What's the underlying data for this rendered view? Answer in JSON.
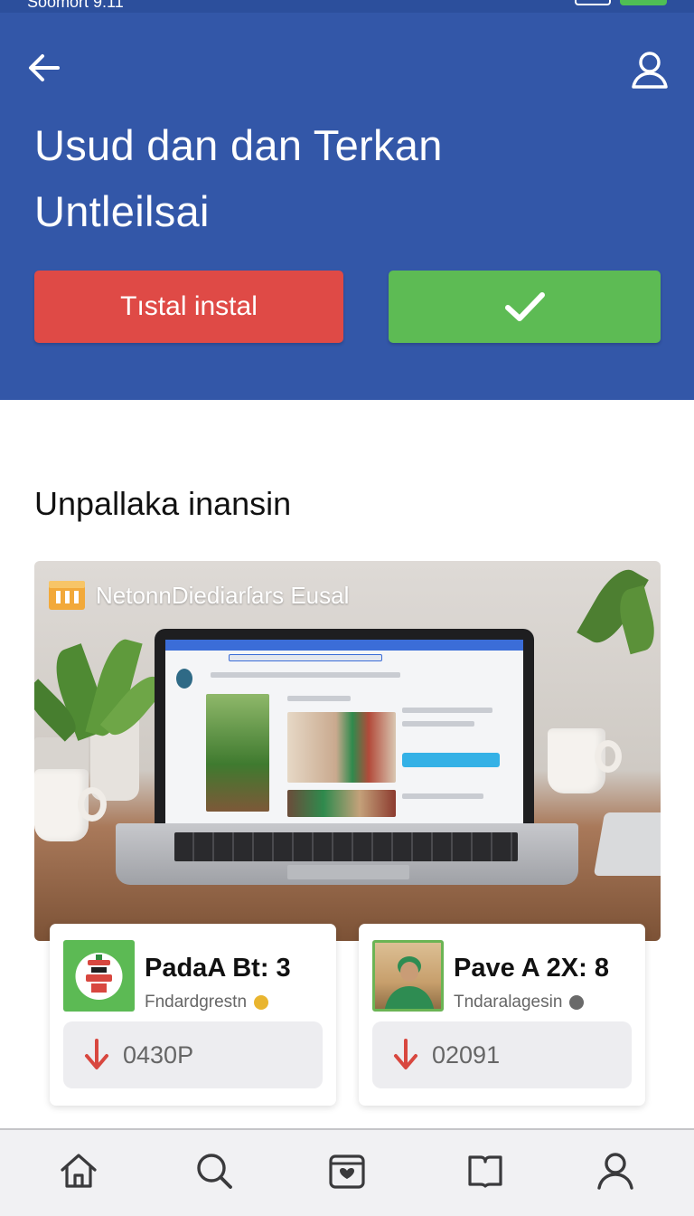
{
  "status_bar": {
    "left_text": "Soomort 9:11"
  },
  "header": {
    "title_line1": "Usud dan dan Terkan",
    "title_line2": "Untleilsai",
    "install_label": "Tıstal instal"
  },
  "section": {
    "title": "Unpallaka inansin",
    "feature_label": "NetonnDiediarſars Eusal"
  },
  "cards": [
    {
      "title": "PadaA Bt: 3",
      "subtitle": "Fndardgrestn",
      "value": "0430P",
      "badge_color": "#e9b52f"
    },
    {
      "title": "Pave A 2X: 8",
      "subtitle": "Tndaralagesin",
      "value": "02091",
      "badge_color": "#6a6a6a"
    }
  ],
  "nav": [
    "home-icon",
    "search-icon",
    "inbox-icon",
    "book-icon",
    "profile-icon"
  ],
  "colors": {
    "header_bg": "#3357a8",
    "install_bg": "#df4a46",
    "confirm_bg": "#5dbb54",
    "download_red": "#d8473f"
  }
}
